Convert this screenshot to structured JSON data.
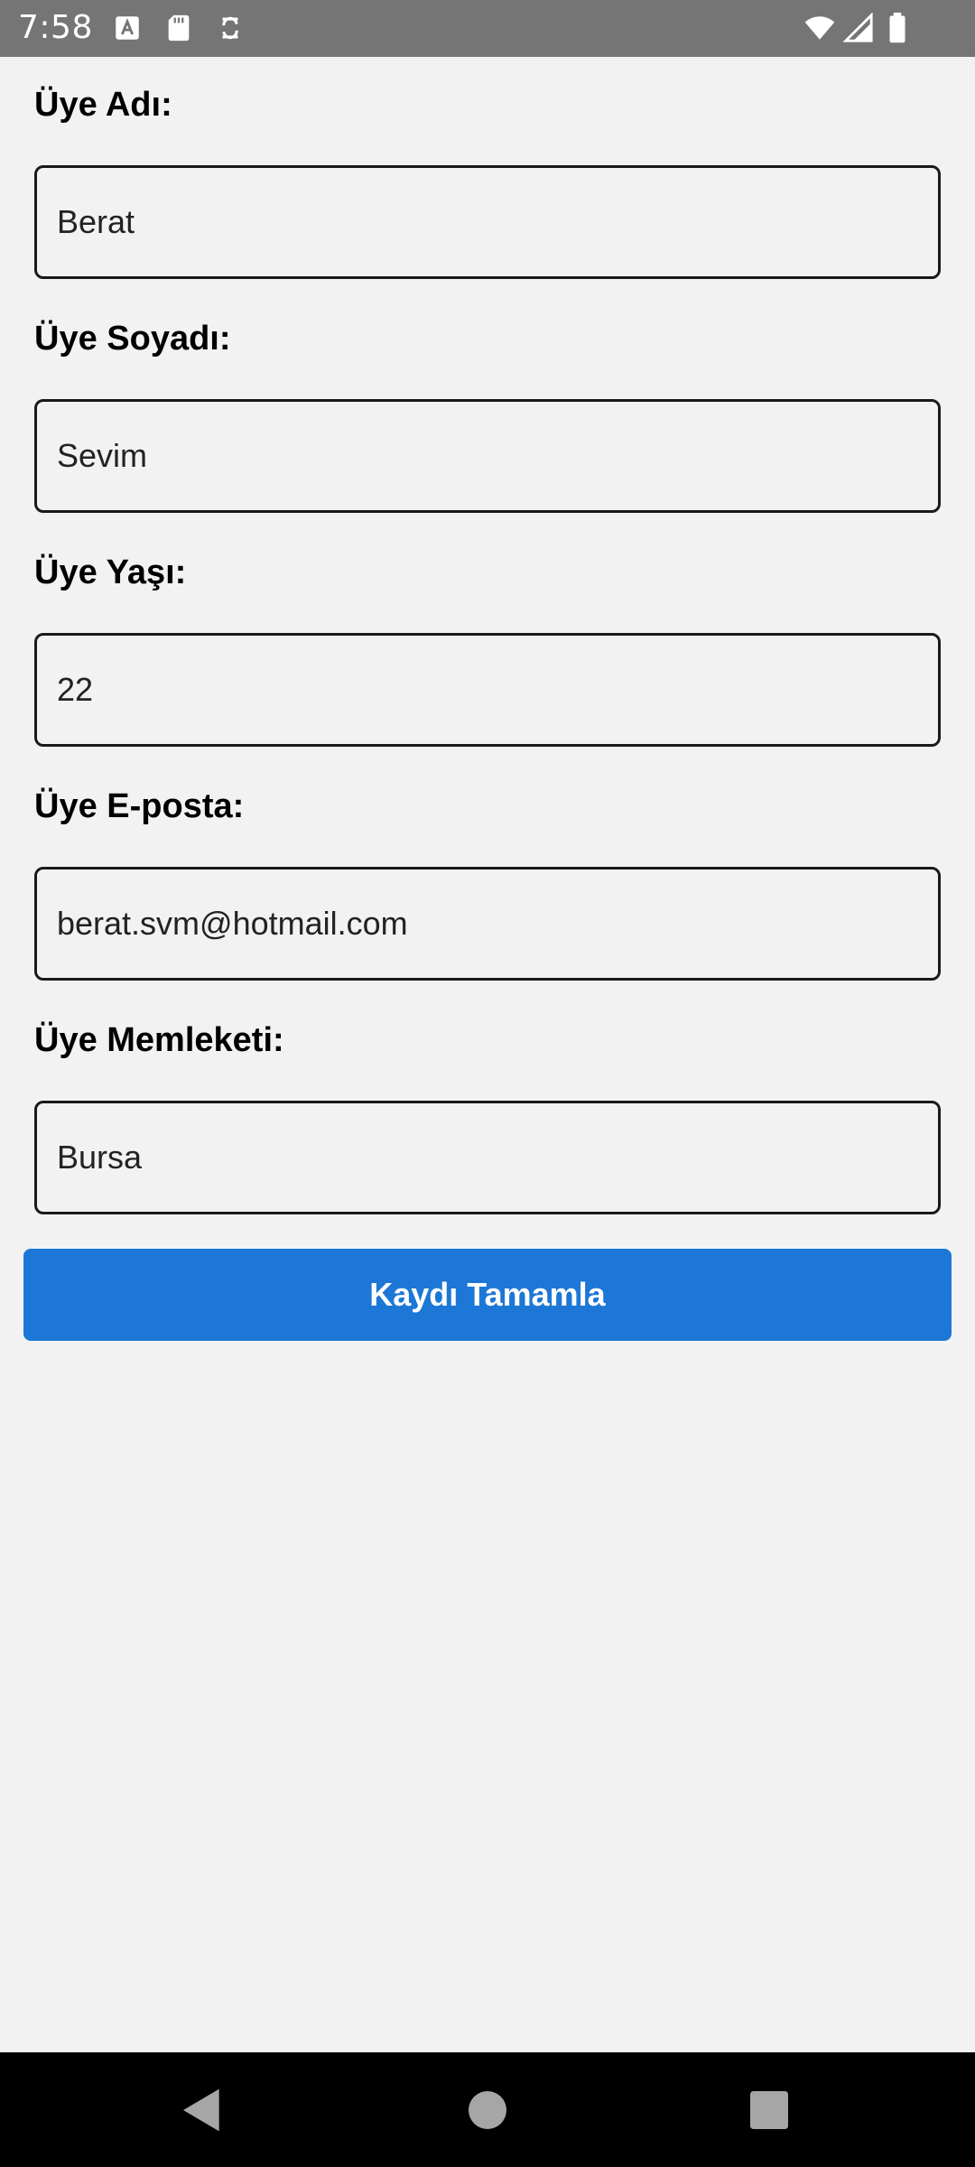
{
  "status_bar": {
    "time": "7:58",
    "left_icons": [
      "a-notification-icon",
      "sd-card-icon",
      "sync-icon"
    ],
    "right_icons": [
      "wifi-icon",
      "signal-icon",
      "battery-icon"
    ]
  },
  "form": {
    "fields": [
      {
        "label": "Üye Adı:",
        "value": "Berat"
      },
      {
        "label": "Üye Soyadı:",
        "value": "Sevim"
      },
      {
        "label": "Üye Yaşı:",
        "value": "22"
      },
      {
        "label": "Üye E-posta:",
        "value": "berat.svm@hotmail.com"
      },
      {
        "label": "Üye Memleketi:",
        "value": "Bursa"
      }
    ],
    "submit_label": "Kaydı Tamamla"
  },
  "navigation": {
    "buttons": [
      "back",
      "home",
      "recents"
    ]
  },
  "colors": {
    "status_bar": "#757575",
    "background": "#f2f2f2",
    "accent": "#1c77d6",
    "nav_bar": "#000000"
  }
}
